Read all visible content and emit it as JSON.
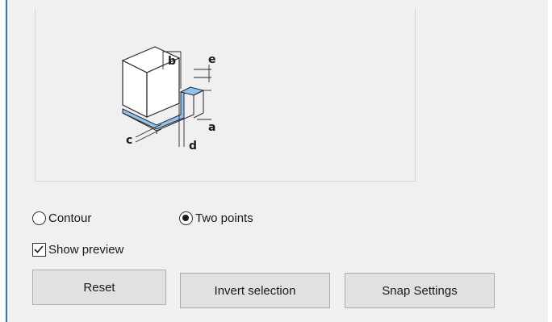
{
  "options": {
    "contour_label": "Contour",
    "two_points_label": "Two points",
    "selected": "Two points",
    "show_preview_label": "Show preview",
    "show_preview_checked": true
  },
  "diagram": {
    "labels": {
      "a": "a",
      "b": "b",
      "c": "c",
      "d": "d",
      "e": "e"
    },
    "highlight_color": "#8ec3f0"
  },
  "buttons": {
    "reset_label": "Reset",
    "invert_selection_label": "Invert selection",
    "snap_settings_label": "Snap Settings"
  },
  "colors": {
    "panel_bg": "#f0f0f0",
    "button_bg": "#e1e1e1",
    "accent": "#2b78c8"
  }
}
